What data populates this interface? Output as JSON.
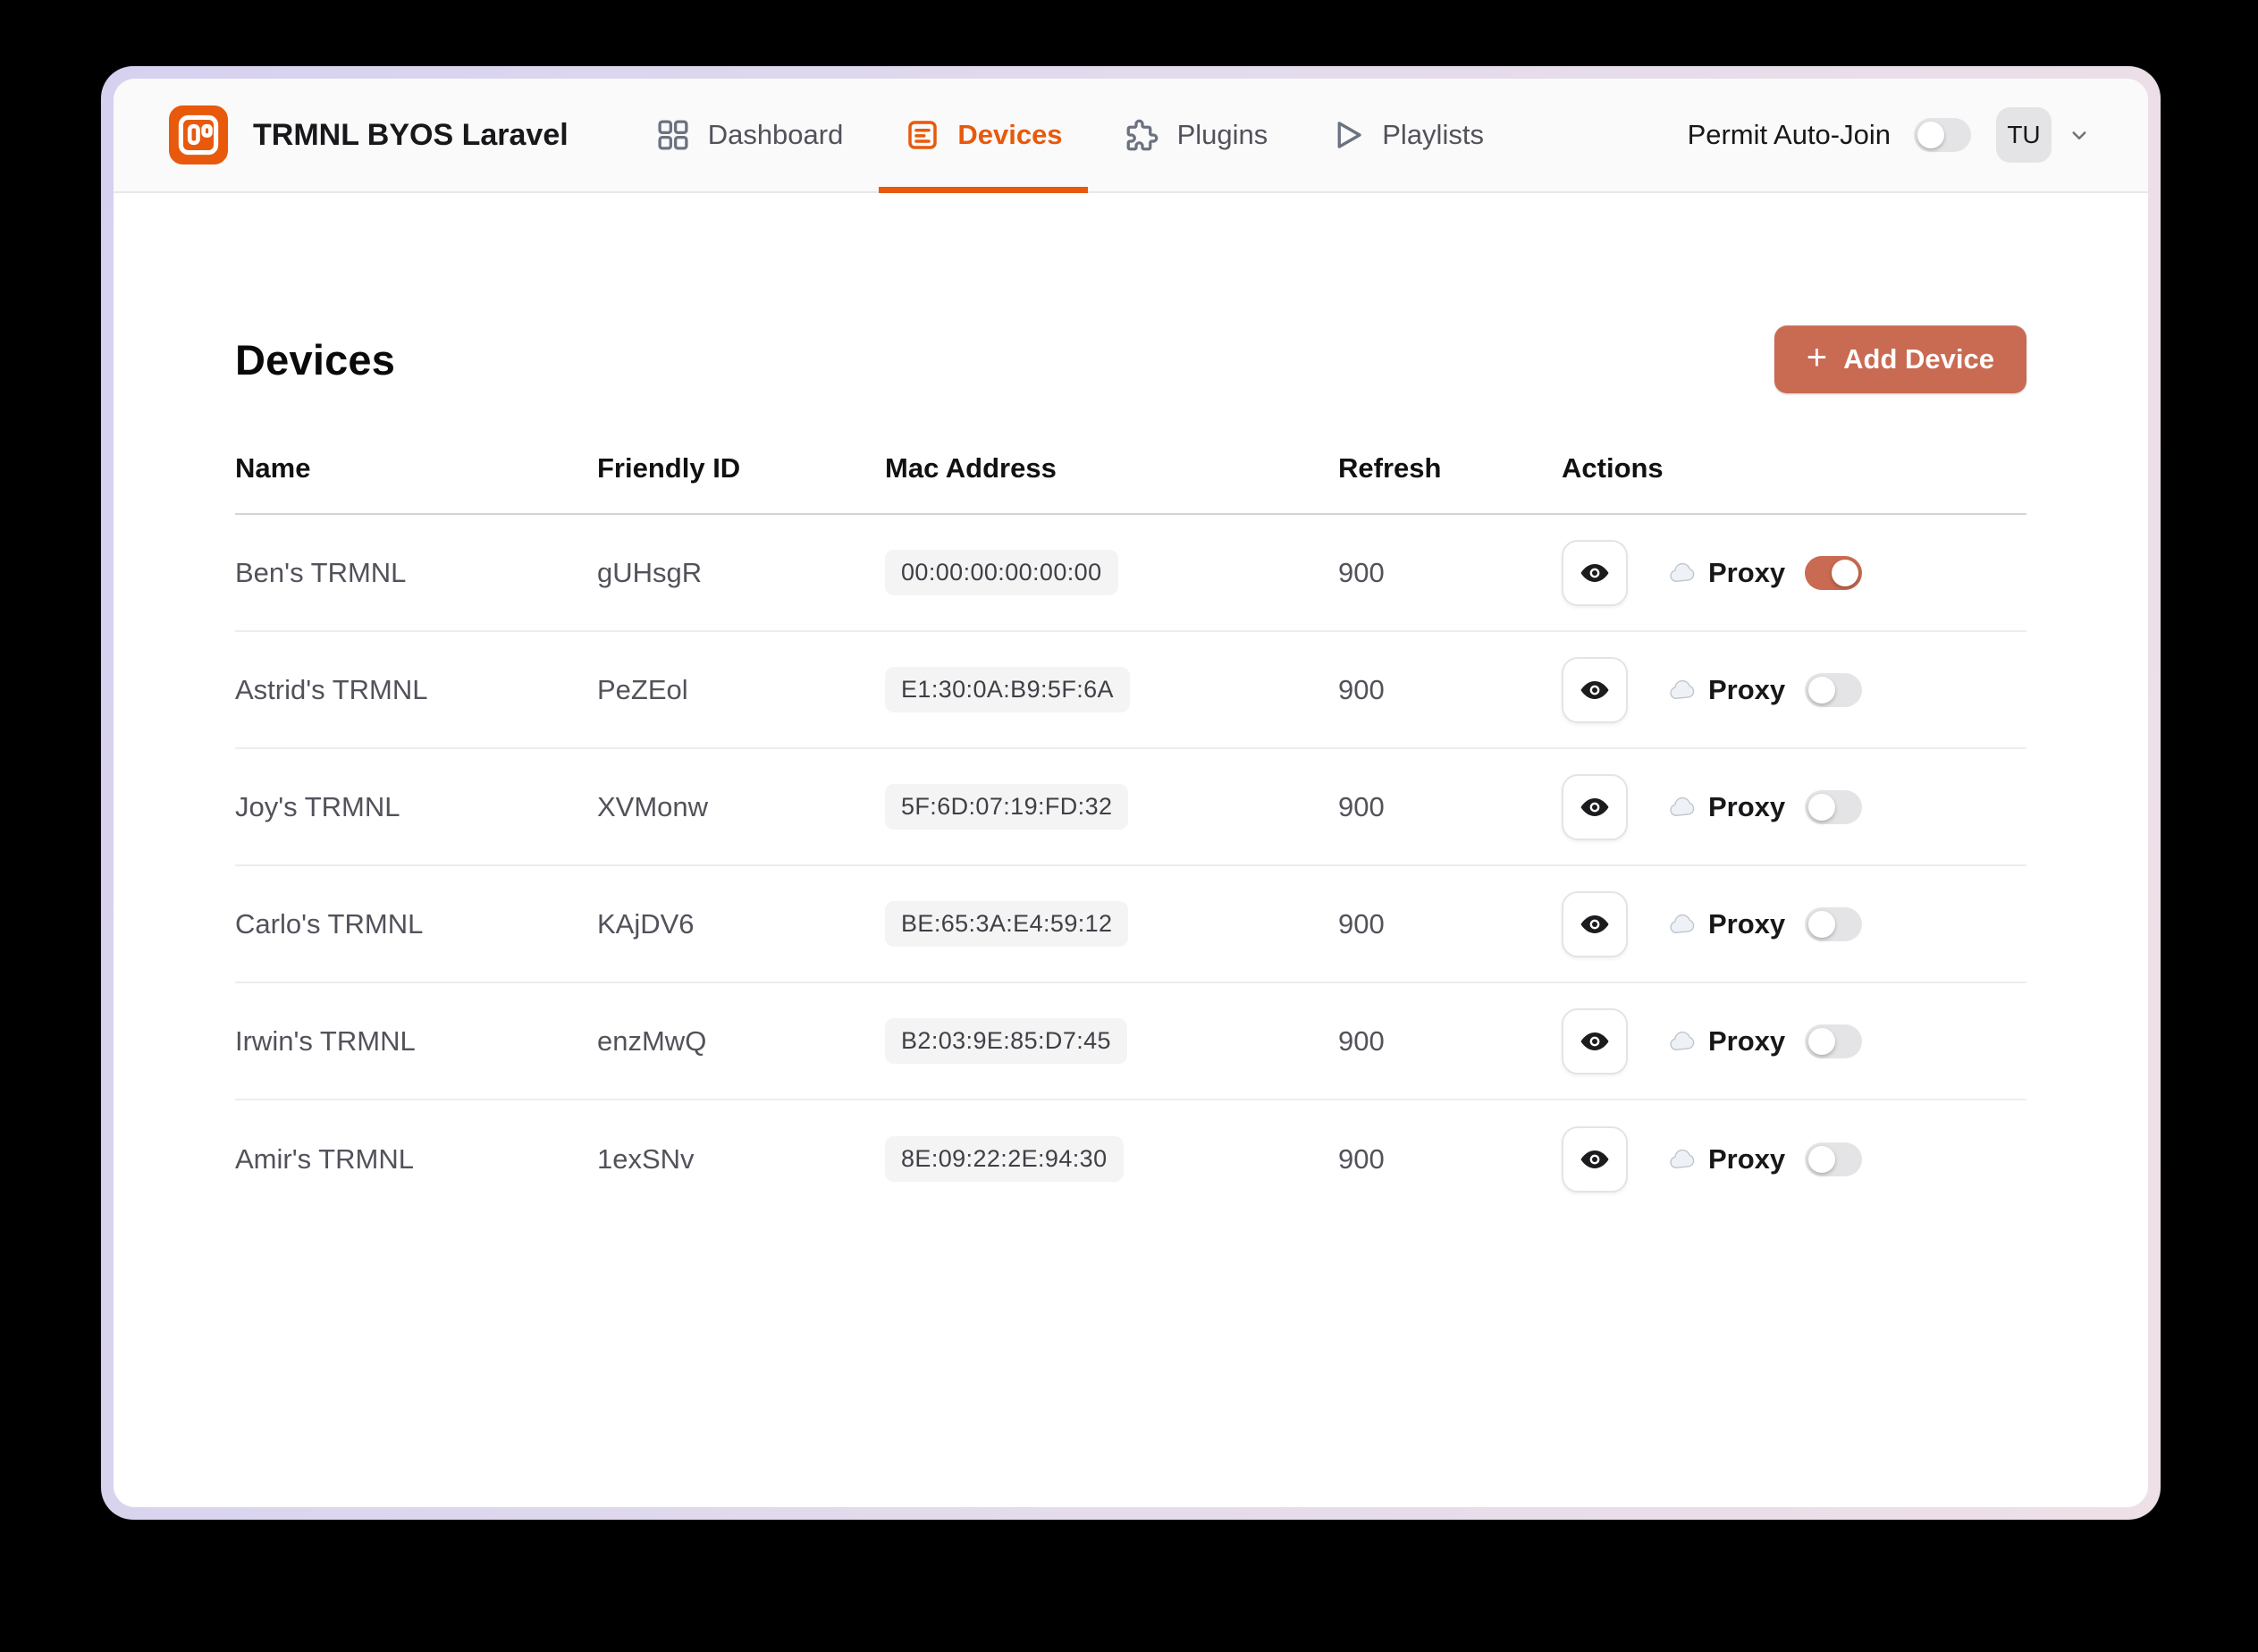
{
  "app": {
    "title": "TRMNL BYOS Laravel",
    "nav": [
      {
        "label": "Dashboard",
        "icon": "grid-icon",
        "active": false
      },
      {
        "label": "Devices",
        "icon": "device-list-icon",
        "active": true
      },
      {
        "label": "Plugins",
        "icon": "puzzle-icon",
        "active": false
      },
      {
        "label": "Playlists",
        "icon": "play-icon",
        "active": false
      }
    ],
    "permit_auto_join": {
      "label": "Permit Auto-Join",
      "enabled": false
    },
    "user": {
      "initials": "TU"
    }
  },
  "page": {
    "title": "Devices",
    "add_button": {
      "label": "Add Device",
      "plus": "+"
    }
  },
  "table": {
    "columns": [
      "Name",
      "Friendly ID",
      "Mac Address",
      "Refresh",
      "Actions"
    ],
    "rows": [
      {
        "name": "Ben's TRMNL",
        "friendly_id": "gUHsgR",
        "mac": "00:00:00:00:00:00",
        "refresh": "900",
        "proxy_label": "Proxy",
        "proxy_enabled": true
      },
      {
        "name": "Astrid's TRMNL",
        "friendly_id": "PeZEol",
        "mac": "E1:30:0A:B9:5F:6A",
        "refresh": "900",
        "proxy_label": "Proxy",
        "proxy_enabled": false
      },
      {
        "name": "Joy's TRMNL",
        "friendly_id": "XVMonw",
        "mac": "5F:6D:07:19:FD:32",
        "refresh": "900",
        "proxy_label": "Proxy",
        "proxy_enabled": false
      },
      {
        "name": "Carlo's TRMNL",
        "friendly_id": "KAjDV6",
        "mac": "BE:65:3A:E4:59:12",
        "refresh": "900",
        "proxy_label": "Proxy",
        "proxy_enabled": false
      },
      {
        "name": "Irwin's TRMNL",
        "friendly_id": "enzMwQ",
        "mac": "B2:03:9E:85:D7:45",
        "refresh": "900",
        "proxy_label": "Proxy",
        "proxy_enabled": false
      },
      {
        "name": "Amir's TRMNL",
        "friendly_id": "1exSNv",
        "mac": "8E:09:22:2E:94:30",
        "refresh": "900",
        "proxy_label": "Proxy",
        "proxy_enabled": false
      }
    ]
  },
  "colors": {
    "accent_orange": "#e8590c",
    "button_salmon": "#c96a52",
    "toggle_off": "#e4e4e7",
    "header_bg": "#fafafa",
    "frame_gradient_start": "#d6d1ef",
    "frame_gradient_end": "#eee0e7"
  }
}
